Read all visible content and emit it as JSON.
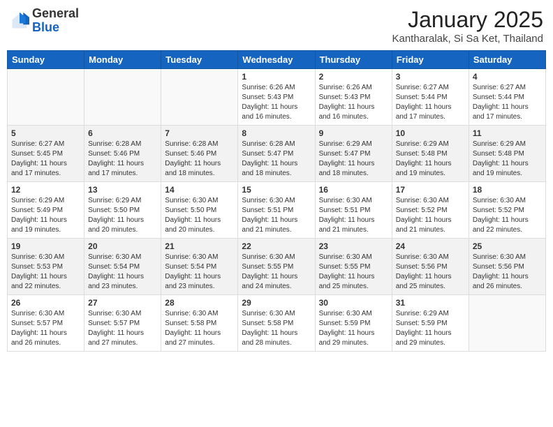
{
  "header": {
    "logo_general": "General",
    "logo_blue": "Blue",
    "month_title": "January 2025",
    "location": "Kantharalak, Si Sa Ket, Thailand"
  },
  "weekdays": [
    "Sunday",
    "Monday",
    "Tuesday",
    "Wednesday",
    "Thursday",
    "Friday",
    "Saturday"
  ],
  "weeks": [
    [
      {
        "day": "",
        "info": ""
      },
      {
        "day": "",
        "info": ""
      },
      {
        "day": "",
        "info": ""
      },
      {
        "day": "1",
        "info": "Sunrise: 6:26 AM\nSunset: 5:43 PM\nDaylight: 11 hours\nand 16 minutes."
      },
      {
        "day": "2",
        "info": "Sunrise: 6:26 AM\nSunset: 5:43 PM\nDaylight: 11 hours\nand 16 minutes."
      },
      {
        "day": "3",
        "info": "Sunrise: 6:27 AM\nSunset: 5:44 PM\nDaylight: 11 hours\nand 17 minutes."
      },
      {
        "day": "4",
        "info": "Sunrise: 6:27 AM\nSunset: 5:44 PM\nDaylight: 11 hours\nand 17 minutes."
      }
    ],
    [
      {
        "day": "5",
        "info": "Sunrise: 6:27 AM\nSunset: 5:45 PM\nDaylight: 11 hours\nand 17 minutes."
      },
      {
        "day": "6",
        "info": "Sunrise: 6:28 AM\nSunset: 5:46 PM\nDaylight: 11 hours\nand 17 minutes."
      },
      {
        "day": "7",
        "info": "Sunrise: 6:28 AM\nSunset: 5:46 PM\nDaylight: 11 hours\nand 18 minutes."
      },
      {
        "day": "8",
        "info": "Sunrise: 6:28 AM\nSunset: 5:47 PM\nDaylight: 11 hours\nand 18 minutes."
      },
      {
        "day": "9",
        "info": "Sunrise: 6:29 AM\nSunset: 5:47 PM\nDaylight: 11 hours\nand 18 minutes."
      },
      {
        "day": "10",
        "info": "Sunrise: 6:29 AM\nSunset: 5:48 PM\nDaylight: 11 hours\nand 19 minutes."
      },
      {
        "day": "11",
        "info": "Sunrise: 6:29 AM\nSunset: 5:48 PM\nDaylight: 11 hours\nand 19 minutes."
      }
    ],
    [
      {
        "day": "12",
        "info": "Sunrise: 6:29 AM\nSunset: 5:49 PM\nDaylight: 11 hours\nand 19 minutes."
      },
      {
        "day": "13",
        "info": "Sunrise: 6:29 AM\nSunset: 5:50 PM\nDaylight: 11 hours\nand 20 minutes."
      },
      {
        "day": "14",
        "info": "Sunrise: 6:30 AM\nSunset: 5:50 PM\nDaylight: 11 hours\nand 20 minutes."
      },
      {
        "day": "15",
        "info": "Sunrise: 6:30 AM\nSunset: 5:51 PM\nDaylight: 11 hours\nand 21 minutes."
      },
      {
        "day": "16",
        "info": "Sunrise: 6:30 AM\nSunset: 5:51 PM\nDaylight: 11 hours\nand 21 minutes."
      },
      {
        "day": "17",
        "info": "Sunrise: 6:30 AM\nSunset: 5:52 PM\nDaylight: 11 hours\nand 21 minutes."
      },
      {
        "day": "18",
        "info": "Sunrise: 6:30 AM\nSunset: 5:52 PM\nDaylight: 11 hours\nand 22 minutes."
      }
    ],
    [
      {
        "day": "19",
        "info": "Sunrise: 6:30 AM\nSunset: 5:53 PM\nDaylight: 11 hours\nand 22 minutes."
      },
      {
        "day": "20",
        "info": "Sunrise: 6:30 AM\nSunset: 5:54 PM\nDaylight: 11 hours\nand 23 minutes."
      },
      {
        "day": "21",
        "info": "Sunrise: 6:30 AM\nSunset: 5:54 PM\nDaylight: 11 hours\nand 23 minutes."
      },
      {
        "day": "22",
        "info": "Sunrise: 6:30 AM\nSunset: 5:55 PM\nDaylight: 11 hours\nand 24 minutes."
      },
      {
        "day": "23",
        "info": "Sunrise: 6:30 AM\nSunset: 5:55 PM\nDaylight: 11 hours\nand 25 minutes."
      },
      {
        "day": "24",
        "info": "Sunrise: 6:30 AM\nSunset: 5:56 PM\nDaylight: 11 hours\nand 25 minutes."
      },
      {
        "day": "25",
        "info": "Sunrise: 6:30 AM\nSunset: 5:56 PM\nDaylight: 11 hours\nand 26 minutes."
      }
    ],
    [
      {
        "day": "26",
        "info": "Sunrise: 6:30 AM\nSunset: 5:57 PM\nDaylight: 11 hours\nand 26 minutes."
      },
      {
        "day": "27",
        "info": "Sunrise: 6:30 AM\nSunset: 5:57 PM\nDaylight: 11 hours\nand 27 minutes."
      },
      {
        "day": "28",
        "info": "Sunrise: 6:30 AM\nSunset: 5:58 PM\nDaylight: 11 hours\nand 27 minutes."
      },
      {
        "day": "29",
        "info": "Sunrise: 6:30 AM\nSunset: 5:58 PM\nDaylight: 11 hours\nand 28 minutes."
      },
      {
        "day": "30",
        "info": "Sunrise: 6:30 AM\nSunset: 5:59 PM\nDaylight: 11 hours\nand 29 minutes."
      },
      {
        "day": "31",
        "info": "Sunrise: 6:29 AM\nSunset: 5:59 PM\nDaylight: 11 hours\nand 29 minutes."
      },
      {
        "day": "",
        "info": ""
      }
    ]
  ]
}
